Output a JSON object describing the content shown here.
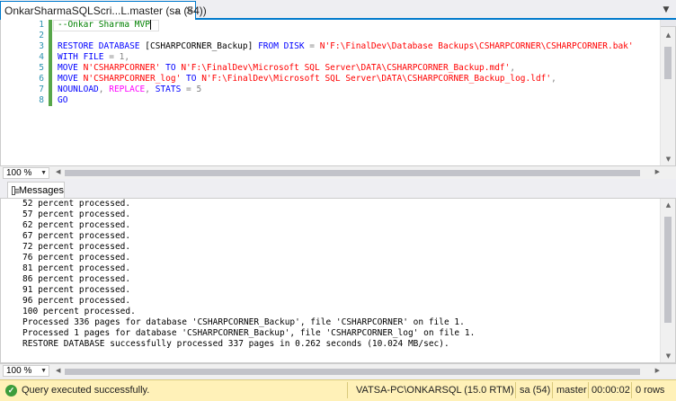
{
  "tab": {
    "title": "OnkarSharmaSQLScri...L.master (sa (54))",
    "pin_icon": "pin-icon",
    "close_icon": "close-icon"
  },
  "editor": {
    "line_numbers": [
      "1",
      "2",
      "3",
      "4",
      "5",
      "6",
      "7",
      "8"
    ],
    "lines": {
      "l1_comment": "--Onkar Sharma MVP",
      "l3_restore": "RESTORE DATABASE",
      "l3_db": " [CSHARPCORNER_Backup] ",
      "l3_from": "FROM DISK",
      "l3_eq": " = ",
      "l3_path": "N'F:\\FinalDev\\Database Backups\\CSHARPCORNER\\CSHARPCORNER.bak'",
      "l4_with": "WITH FILE",
      "l4_rest": " = 1,",
      "l5_move": "MOVE",
      "l5_src": "N'CSHARPCORNER'",
      "l5_to": " TO ",
      "l5_dst": "N'F:\\FinalDev\\Microsoft SQL Server\\DATA\\CSHARPCORNER_Backup.mdf'",
      "l5_end": ",",
      "l6_move": "MOVE",
      "l6_src": "N'CSHARPCORNER_log'",
      "l6_to": " TO ",
      "l6_dst": "N'F:\\FinalDev\\Microsoft SQL Server\\DATA\\CSHARPCORNER_Backup_log.ldf'",
      "l6_end": ",",
      "l7_nounload": "NOUNLOAD",
      "l7_c1": ", ",
      "l7_replace": "REPLACE",
      "l7_c2": ", ",
      "l7_stats": "STATS",
      "l7_rest": " = 5",
      "l8_go": "GO"
    },
    "zoom": "100 %"
  },
  "results": {
    "tab_label": "Messages",
    "messages": [
      "52 percent processed.",
      "57 percent processed.",
      "62 percent processed.",
      "67 percent processed.",
      "72 percent processed.",
      "76 percent processed.",
      "81 percent processed.",
      "86 percent processed.",
      "91 percent processed.",
      "96 percent processed.",
      "100 percent processed.",
      "Processed 336 pages for database 'CSHARPCORNER_Backup', file 'CSHARPCORNER' on file 1.",
      "Processed 1 pages for database 'CSHARPCORNER_Backup', file 'CSHARPCORNER_log' on file 1.",
      "RESTORE DATABASE successfully processed 337 pages in 0.262 seconds (10.024 MB/sec)."
    ],
    "zoom": "100 %"
  },
  "status": {
    "message": "Query executed successfully.",
    "server": "VATSA-PC\\ONKARSQL (15.0 RTM)",
    "user": "sa (54)",
    "database": "master",
    "elapsed": "00:00:02",
    "rows": "0 rows",
    "accent_color": "#fff1b8"
  }
}
